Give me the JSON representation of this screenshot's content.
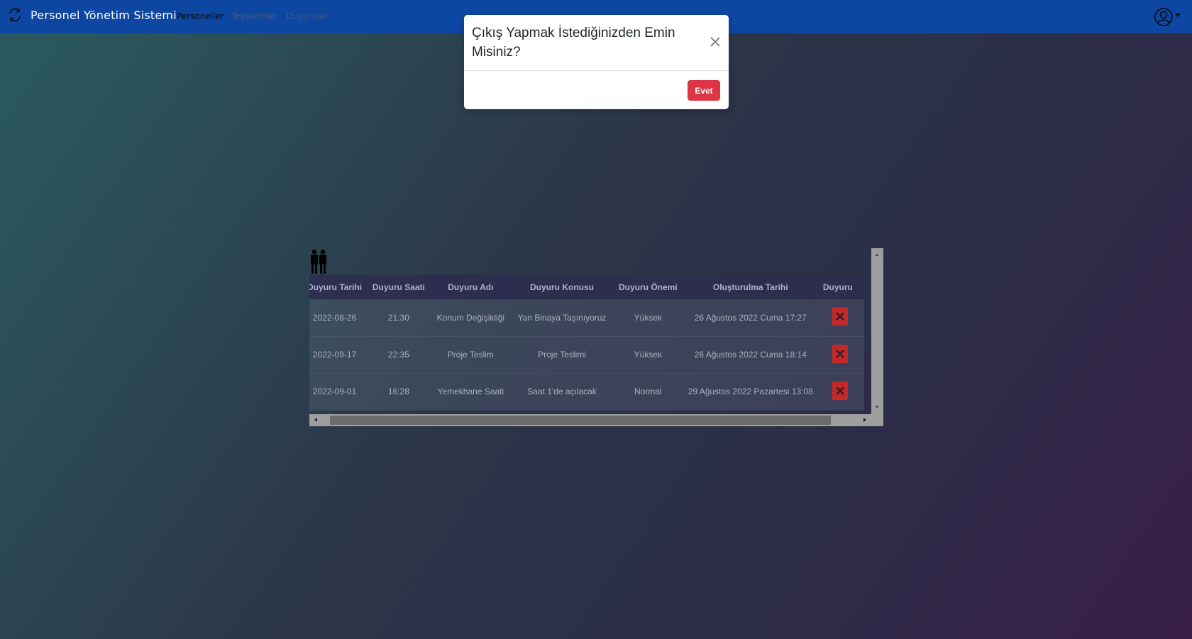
{
  "navbar": {
    "brand": "Personel Yönetim Sistemi",
    "links": [
      "Personeller",
      "Toplantılar",
      "Duyurular"
    ]
  },
  "modal": {
    "title": "Çıkış Yapmak İstediğinizden Emin Misiniz?",
    "confirm_label": "Evet"
  },
  "table": {
    "headers": [
      "Duyuru Tarihi",
      "Duyuru Saati",
      "Duyuru Adı",
      "Duyuru Konusu",
      "Duyuru Önemi",
      "Oluşturulma Tarihi",
      "Duyuru"
    ],
    "rows": [
      [
        "2022-08-26",
        "21:30",
        "Konum Değişikliği",
        "Yan Binaya Taşınıyoruz",
        "Yüksek",
        "26 Ağustos 2022 Cuma 17:27"
      ],
      [
        "2022-09-17",
        "22:35",
        "Proje Teslim",
        "Proje Teslimi",
        "Yüksek",
        "26 Ağustos 2022 Cuma 18:14"
      ],
      [
        "2022-09-01",
        "16:28",
        "Yemekhane Saati",
        "Saat 1'de açılacak",
        "Normal",
        "29 Ağustos 2022 Pazartesi 13:08"
      ]
    ]
  },
  "colors": {
    "navbar": "#0d47a1",
    "danger": "#dc3545"
  },
  "icons": [
    "brand-sync-icon",
    "user-circle-icon",
    "people-icon",
    "close-icon",
    "delete-x-icon"
  ]
}
